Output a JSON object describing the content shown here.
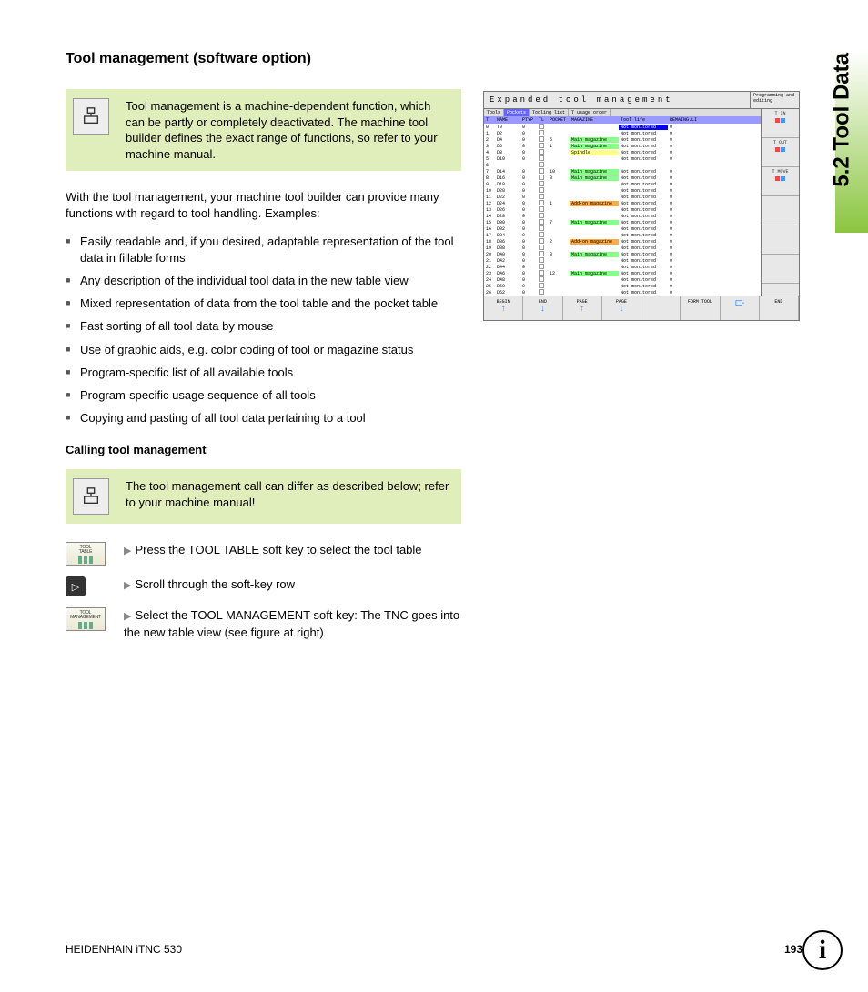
{
  "section_tab": "5.2 Tool Data",
  "heading": "Tool management (software option)",
  "note1": "Tool management is a machine-dependent function, which can be partly or completely deactivated. The machine tool builder defines the exact range of functions, so refer to your machine manual.",
  "para1": "With the tool management, your machine tool builder can provide many functions with regard to tool handling. Examples:",
  "bullets": [
    "Easily readable and, if you desired, adaptable representation of the tool data in fillable forms",
    "Any description of the individual tool data in the new table view",
    "Mixed representation of data from the tool table and the pocket table",
    "Fast sorting of all tool data by mouse",
    "Use of graphic aids, e.g. color coding of tool or magazine status",
    "Program-specific list of all available tools",
    "Program-specific usage sequence of all tools",
    "Copying and pasting of all tool data pertaining to a tool"
  ],
  "subheading": "Calling tool management",
  "note2": "The tool management call can differ as described below; refer to your machine manual!",
  "steps": [
    {
      "key": "TOOL TABLE",
      "text": "Press the TOOL TABLE soft key to select the tool table"
    },
    {
      "key": "scroll",
      "text": "Scroll through the soft-key row"
    },
    {
      "key": "TOOL MANAGEMENT",
      "text": "Select the TOOL MANAGEMENT soft key: The TNC goes into the new table view (see figure at right)"
    }
  ],
  "shot": {
    "title": "Expanded tool management",
    "mode": "Programming and editing",
    "tabs": [
      "Tools",
      "Pockets",
      "Tooling list",
      "T usage order"
    ],
    "thead": [
      "T",
      "NAME",
      "PTYP",
      "TL",
      "POCKET",
      "MAGAZINE",
      "Tool life",
      "REMAING.LI"
    ],
    "rows": [
      {
        "t": "0",
        "n": "T0",
        "p": "0",
        "pk": "",
        "mg": "",
        "mgc": "",
        "lf": "Not monitored",
        "lfc": "life-sel",
        "r": "0"
      },
      {
        "t": "1",
        "n": "D2",
        "p": "0",
        "pk": "",
        "mg": "",
        "mgc": "",
        "lf": "Not monitored",
        "lfc": "",
        "r": "0"
      },
      {
        "t": "2",
        "n": "D4",
        "p": "0",
        "pk": "5",
        "mg": "Main magazine",
        "mgc": "mg-main",
        "lf": "Not monitored",
        "lfc": "",
        "r": "0"
      },
      {
        "t": "3",
        "n": "D6",
        "p": "0",
        "pk": "1",
        "mg": "Main magazine",
        "mgc": "mg-main",
        "lf": "Not monitored",
        "lfc": "",
        "r": "0"
      },
      {
        "t": "4",
        "n": "D8",
        "p": "0",
        "pk": "",
        "mg": "Spindle",
        "mgc": "mg-spin",
        "lf": "Not monitored",
        "lfc": "",
        "r": "0"
      },
      {
        "t": "5",
        "n": "D10",
        "p": "0",
        "pk": "",
        "mg": "",
        "mgc": "",
        "lf": "Not monitored",
        "lfc": "",
        "r": "0"
      },
      {
        "t": "6",
        "n": "",
        "p": "",
        "pk": "",
        "mg": "",
        "mgc": "",
        "lf": "",
        "lfc": "",
        "r": ""
      },
      {
        "t": "7",
        "n": "D14",
        "p": "0",
        "pk": "10",
        "mg": "Main magazine",
        "mgc": "mg-main",
        "lf": "Not monitored",
        "lfc": "",
        "r": "0"
      },
      {
        "t": "8",
        "n": "D16",
        "p": "0",
        "pk": "3",
        "mg": "Main magazine",
        "mgc": "mg-main",
        "lf": "Not monitored",
        "lfc": "",
        "r": "0"
      },
      {
        "t": "9",
        "n": "D18",
        "p": "0",
        "pk": "",
        "mg": "",
        "mgc": "",
        "lf": "Not monitored",
        "lfc": "",
        "r": "0"
      },
      {
        "t": "10",
        "n": "D20",
        "p": "0",
        "pk": "",
        "mg": "",
        "mgc": "",
        "lf": "Not monitored",
        "lfc": "",
        "r": "0"
      },
      {
        "t": "11",
        "n": "D22",
        "p": "0",
        "pk": "",
        "mg": "",
        "mgc": "",
        "lf": "Not monitored",
        "lfc": "",
        "r": "0"
      },
      {
        "t": "12",
        "n": "D24",
        "p": "0",
        "pk": "1",
        "mg": "Add-on magazine",
        "mgc": "mg-addon",
        "lf": "Not monitored",
        "lfc": "",
        "r": "0"
      },
      {
        "t": "13",
        "n": "D26",
        "p": "0",
        "pk": "",
        "mg": "",
        "mgc": "",
        "lf": "Not monitored",
        "lfc": "",
        "r": "0"
      },
      {
        "t": "14",
        "n": "D28",
        "p": "0",
        "pk": "",
        "mg": "",
        "mgc": "mg-red",
        "lf": "Not monitored",
        "lfc": "",
        "r": "0"
      },
      {
        "t": "15",
        "n": "D30",
        "p": "0",
        "pk": "7",
        "mg": "Main magazine",
        "mgc": "mg-main",
        "lf": "Not monitored",
        "lfc": "",
        "r": "0"
      },
      {
        "t": "16",
        "n": "D32",
        "p": "0",
        "pk": "",
        "mg": "",
        "mgc": "",
        "lf": "Not monitored",
        "lfc": "",
        "r": "0"
      },
      {
        "t": "17",
        "n": "D34",
        "p": "0",
        "pk": "",
        "mg": "",
        "mgc": "",
        "lf": "Not monitored",
        "lfc": "",
        "r": "0"
      },
      {
        "t": "18",
        "n": "D36",
        "p": "0",
        "pk": "2",
        "mg": "Add-on magazine",
        "mgc": "mg-addon",
        "lf": "Not monitored",
        "lfc": "",
        "r": "0"
      },
      {
        "t": "19",
        "n": "D38",
        "p": "0",
        "pk": "",
        "mg": "",
        "mgc": "",
        "lf": "Not monitored",
        "lfc": "",
        "r": "0"
      },
      {
        "t": "20",
        "n": "D40",
        "p": "0",
        "pk": "8",
        "mg": "Main magazine",
        "mgc": "mg-main",
        "lf": "Not monitored",
        "lfc": "",
        "r": "0"
      },
      {
        "t": "21",
        "n": "D42",
        "p": "0",
        "pk": "",
        "mg": "",
        "mgc": "",
        "lf": "Not monitored",
        "lfc": "",
        "r": "0"
      },
      {
        "t": "22",
        "n": "D44",
        "p": "0",
        "pk": "",
        "mg": "",
        "mgc": "",
        "lf": "Not monitored",
        "lfc": "",
        "r": "0"
      },
      {
        "t": "23",
        "n": "D46",
        "p": "0",
        "pk": "12",
        "mg": "Main magazine",
        "mgc": "mg-main",
        "lf": "Not monitored",
        "lfc": "",
        "r": "0"
      },
      {
        "t": "24",
        "n": "D48",
        "p": "0",
        "pk": "",
        "mg": "",
        "mgc": "",
        "lf": "Not monitored",
        "lfc": "",
        "r": "0"
      },
      {
        "t": "25",
        "n": "D50",
        "p": "0",
        "pk": "",
        "mg": "",
        "mgc": "",
        "lf": "Not monitored",
        "lfc": "",
        "r": "0"
      },
      {
        "t": "26",
        "n": "D52",
        "p": "0",
        "pk": "",
        "mg": "",
        "mgc": "",
        "lf": "Not monitored",
        "lfc": "",
        "r": "0"
      }
    ],
    "side": [
      "T IN",
      "T OUT",
      "T MOVE",
      "",
      "",
      ""
    ],
    "softkeys": [
      "BEGIN",
      "END",
      "PAGE",
      "PAGE",
      "",
      "FORM TOOL",
      "",
      "END"
    ]
  },
  "footer_left": "HEIDENHAIN iTNC 530",
  "footer_page": "193"
}
